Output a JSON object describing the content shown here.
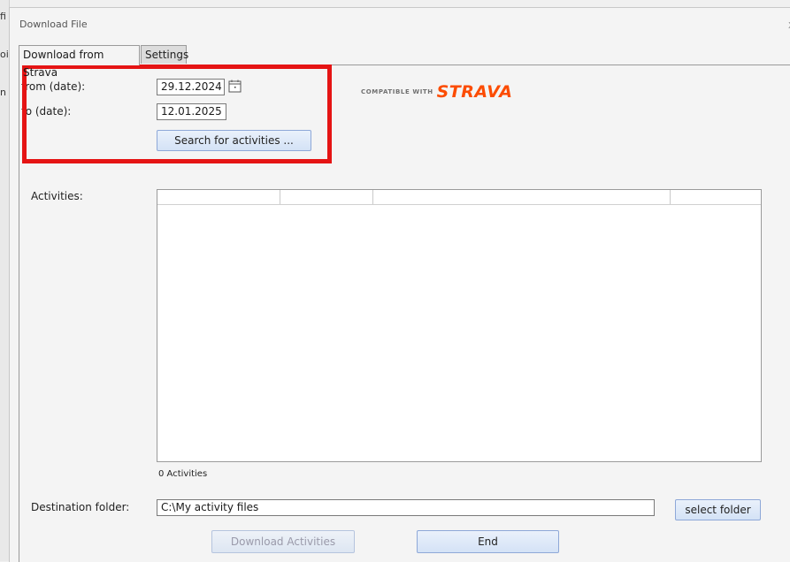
{
  "window": {
    "title": "Download File",
    "close_glyph": "x"
  },
  "background_fragments": [
    "fi",
    "oi",
    "n"
  ],
  "tabs": [
    {
      "label": "Download from Strava",
      "active": true
    },
    {
      "label": "Settings",
      "active": false
    }
  ],
  "form": {
    "from_label": "from (date):",
    "from_value": "29.12.2024",
    "to_label": "to (date):",
    "to_value": "12.01.2025",
    "search_button": "Search for activities ..."
  },
  "branding": {
    "compatible_with": "COMPATIBLE WITH",
    "strava": "STRAVA",
    "strava_color": "#fc4c02"
  },
  "activities": {
    "label": "Activities:",
    "count_text": "0 Activities",
    "columns": [
      "",
      "",
      "",
      ""
    ],
    "rows": []
  },
  "destination": {
    "label": "Destination folder:",
    "path": "C:\\My activity files",
    "select_button": "select folder"
  },
  "footer": {
    "download_button": "Download Activities",
    "end_button": "End"
  },
  "colors": {
    "highlight_border": "#e51414",
    "button_border": "#8ea8d8"
  },
  "icons": {
    "date_picker": "calendar-icon"
  }
}
